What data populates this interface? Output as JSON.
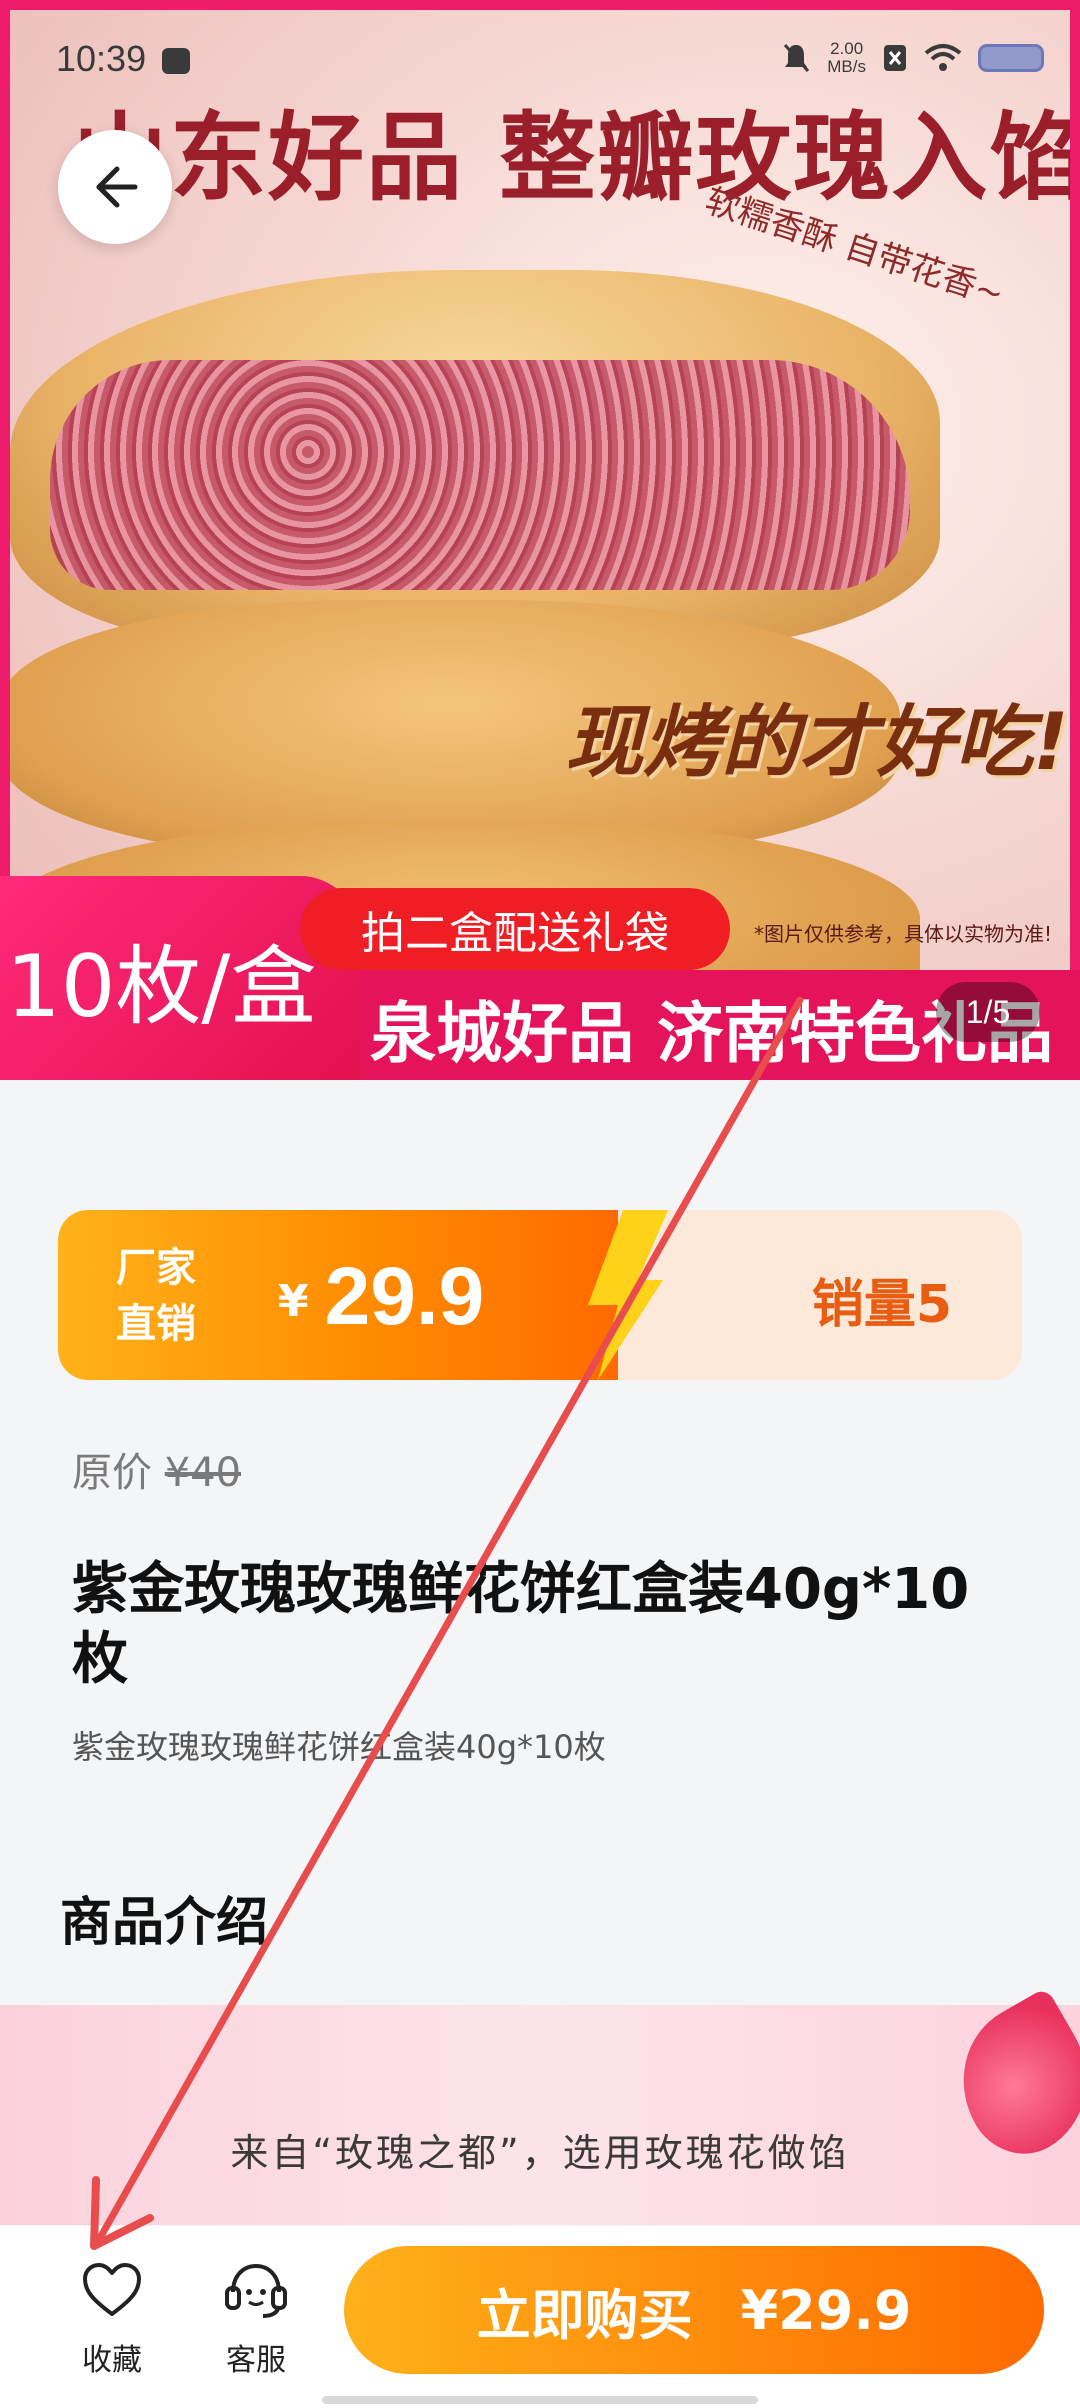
{
  "status_bar": {
    "time": "10:39",
    "net_speed_value": "2.00",
    "net_speed_unit": "MB/s"
  },
  "hero": {
    "headline": "山东好品 整瓣玫瑰入馅",
    "slogan": "软糯香酥 自带花香~",
    "tagline": "现烤的才好吃!",
    "promo": "拍二盒配送礼袋",
    "disclaimer": "*图片仅供参考，具体以实物为准!",
    "badge": "10枚/盒",
    "band": "泉城好品 济南特色礼品",
    "image_counter": "1/5"
  },
  "price": {
    "tag_line1": "厂家",
    "tag_line2": "直销",
    "currency": "¥",
    "amount": "29.9",
    "sales": "销量5"
  },
  "product": {
    "original_label": "原价",
    "original_price": "¥40",
    "title": "紫金玫瑰玫瑰鲜花饼红盒装40g*10枚",
    "subtitle": "紫金玫瑰玫瑰鲜花饼红盒装40g*10枚"
  },
  "intro": {
    "section_title": "商品介绍",
    "banner_text": "来自“玫瑰之都”，选用玫瑰花做馅"
  },
  "bottom_bar": {
    "favorite_label": "收藏",
    "service_label": "客服",
    "buy_label": "立即购买",
    "buy_price": "¥29.9"
  },
  "colors": {
    "accent_pink": "#ec1c6a",
    "accent_orange": "#ff8a0a",
    "arrow_red": "#e84c4c"
  },
  "icons": [
    "back-arrow-icon",
    "heart-icon",
    "headset-icon",
    "lightning-icon",
    "notification-muted-icon",
    "wifi-icon",
    "battery-icon"
  ]
}
